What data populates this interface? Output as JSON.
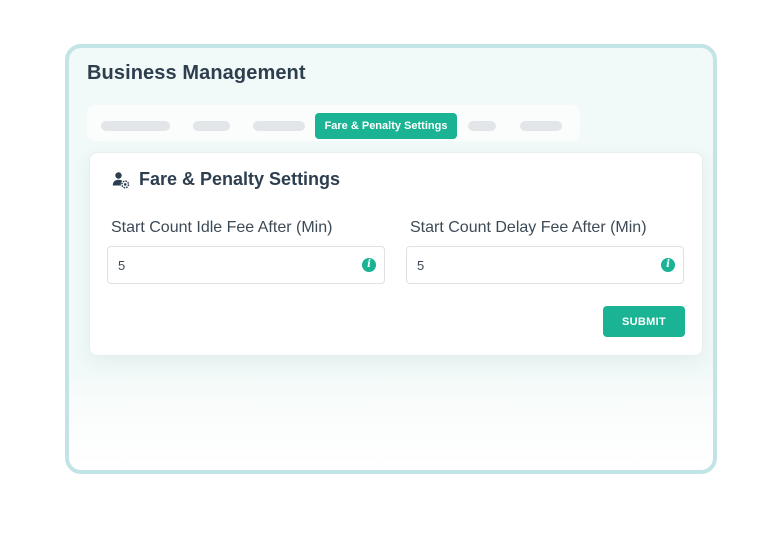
{
  "page": {
    "title": "Business Management"
  },
  "tabs": {
    "active_label": "Fare & Penalty Settings"
  },
  "card": {
    "title": "Fare & Penalty Settings",
    "icon": "user-settings-icon"
  },
  "fields": [
    {
      "label": "Start Count Idle Fee After (Min)",
      "value": "5",
      "icon": "info-icon"
    },
    {
      "label": "Start Count Delay Fee After (Min)",
      "value": "5",
      "icon": "info-icon"
    }
  ],
  "actions": {
    "submit_label": "SUBMIT"
  },
  "colors": {
    "accent": "#1ab394",
    "frame_border": "#c3e4e6",
    "title_text": "#2d3e4e",
    "placeholder_tab": "#e3e6e8"
  }
}
